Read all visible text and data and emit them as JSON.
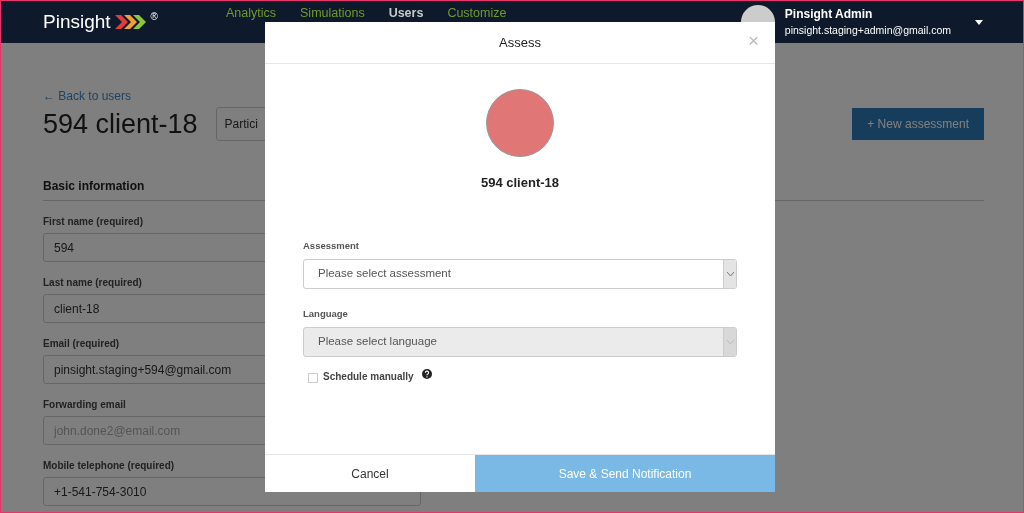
{
  "navbar": {
    "brand": "Pinsight",
    "brand_mark": "®",
    "links": [
      {
        "label": "Analytics",
        "selected": false
      },
      {
        "label": "Simulations",
        "selected": false
      },
      {
        "label": "Users",
        "selected": true
      },
      {
        "label": "Customize",
        "selected": false
      }
    ],
    "user": {
      "name": "Pinsight Admin",
      "email": "pinsight.staging+admin@gmail.com"
    }
  },
  "page": {
    "back_link": "← Back to users",
    "title": "594 client-18",
    "tab_button": "Partici",
    "new_button": "+ New assessment",
    "section": "Basic information",
    "fields": [
      {
        "label": "First name (required)",
        "value": "594"
      },
      {
        "label": "Last name (required)",
        "value": "client-18"
      },
      {
        "label": "Email (required)",
        "value": "pinsight.staging+594@gmail.com"
      },
      {
        "label": "Forwarding email",
        "placeholder": "john.done2@email.com"
      },
      {
        "label": "Mobile telephone (required)",
        "value": "+1-541-754-3010"
      }
    ]
  },
  "modal": {
    "title": "Assess",
    "close": "×",
    "name": "594 client-18",
    "selects": [
      {
        "label": "Assessment",
        "placeholder": "Please select assessment",
        "disabled": false
      },
      {
        "label": "Language",
        "placeholder": "Please select language",
        "disabled": true
      }
    ],
    "checkbox": {
      "label": "Schedule manually",
      "checked": false
    },
    "buttons": [
      {
        "label": "Cancel",
        "kind": "secondary"
      },
      {
        "label": "Save & Send Notification",
        "kind": "primary",
        "disabled": true
      }
    ]
  }
}
